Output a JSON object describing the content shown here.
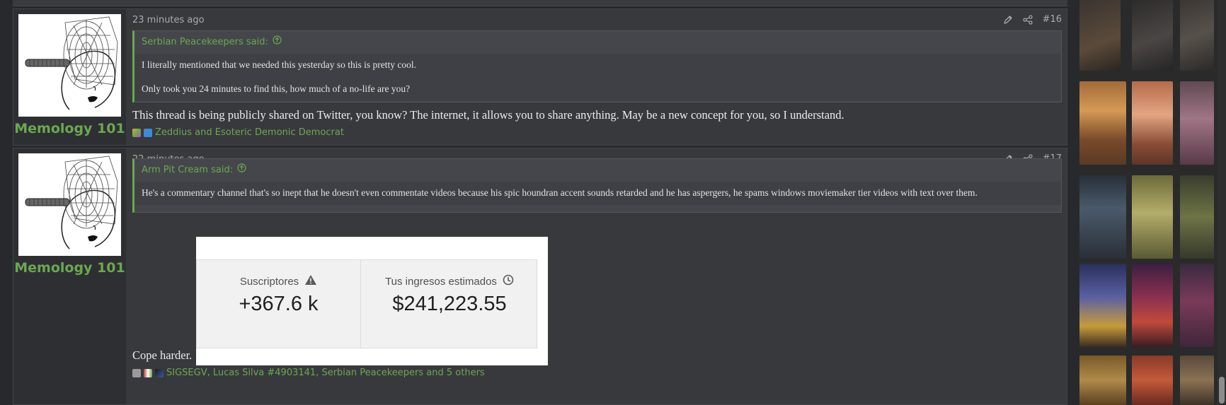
{
  "posts": [
    {
      "username": "Memology 101",
      "time": "23 minutes ago",
      "number": "#16",
      "quote": {
        "author": "Serbian Peacekeepers said:",
        "lines": [
          "I literally mentioned that we needed this yesterday so this is pretty cool.",
          "Only took you 24 minutes to find this, how much of a no-life are you?"
        ]
      },
      "message": "This thread is being publicly shared on Twitter, you know? The internet, it allows you to share anything. May be a new concept for you, so I understand.",
      "reactions": "Zeddius and Esoteric Demonic Democrat"
    },
    {
      "username": "Memology 101",
      "time": "22 minutes ago",
      "number": "#17",
      "quote": {
        "author": "Arm Pit Cream said:",
        "lines": [
          "He's a commentary channel that's so inept that he doesn't even commentate videos because his spic houndran accent sounds retarded and he has aspergers, he spams windows moviemaker tier videos with text over them."
        ]
      },
      "embed": {
        "stat1_label": "Suscriptores",
        "stat1_value": "+367.6 k",
        "stat2_label": "Tus ingresos estimados",
        "stat2_value": "$241,223.55"
      },
      "message": "Cope harder.",
      "reactions": "SIGSEGV, Lucas Silva #4903141, Serbian Peacekeepers and 5 others"
    }
  ],
  "icons": {
    "edit": "pencil-icon",
    "share": "share-icon",
    "quote_jump": "arrow-up-circle-icon",
    "warning": "warning-icon",
    "clock": "clock-icon"
  },
  "colors": {
    "accent": "#6aa84f",
    "post_bg": "#38393d",
    "user_cell_bg": "#2e2f33",
    "quote_bg": "#45464b"
  }
}
